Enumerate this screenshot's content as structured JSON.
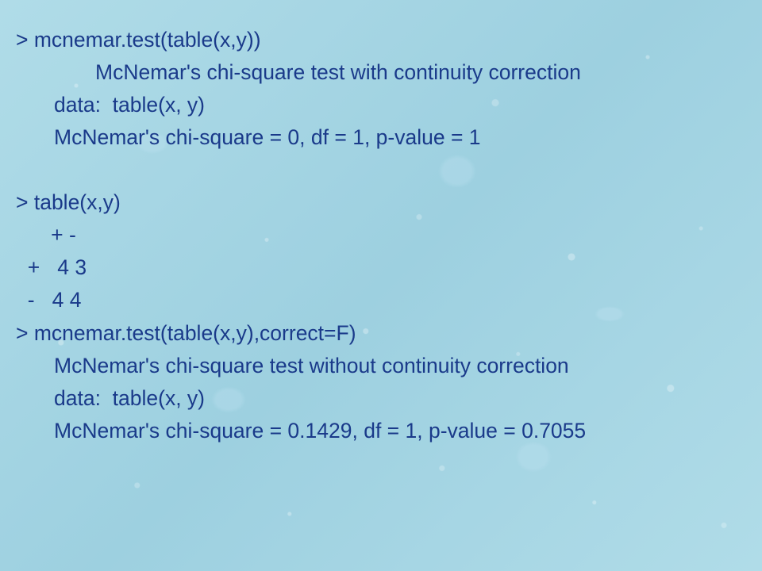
{
  "lines": {
    "l1": "> mcnemar.test(table(x,y))",
    "l2": "McNemar's chi-square test with continuity correction",
    "l3": "data:  table(x, y)",
    "l4": "McNemar's chi-square = 0, df = 1, p-value = 1",
    "l5": "> table(x,y)",
    "l6": "      + -",
    "l7": "  +   4 3",
    "l8": "  -   4 4",
    "l9": "> mcnemar.test(table(x,y),correct=F)",
    "l10": "McNemar's chi-square test without continuity correction",
    "l11": "data:  table(x, y)",
    "l12": "McNemar's chi-square = 0.1429, df = 1, p-value = 0.7055"
  }
}
